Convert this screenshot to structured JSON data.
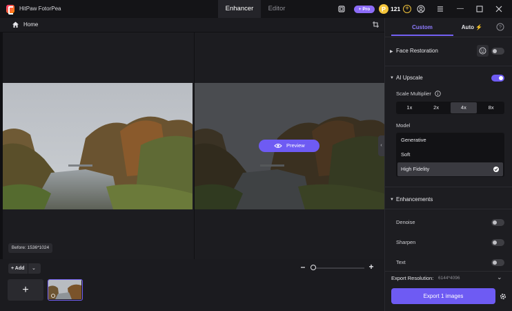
{
  "app": {
    "name": "HitPaw FotorPea"
  },
  "tabs": {
    "enhancer": "Enhancer",
    "editor": "Editor"
  },
  "titlebar": {
    "pro_label": "+ Pro",
    "coins": "121"
  },
  "subbar": {
    "home": "Home"
  },
  "canvas": {
    "preview_label": "Preview",
    "before_label": "Before: 1536*1024"
  },
  "bottom": {
    "add_label": "+ Add"
  },
  "panel": {
    "tab_custom": "Custom",
    "tab_auto": "Auto",
    "face_restoration": {
      "title": "Face Restoration",
      "enabled": false
    },
    "ai_upscale": {
      "title": "AI Upscale",
      "enabled": true,
      "scale_label": "Scale Multiplier",
      "scales": [
        "1x",
        "2x",
        "4x",
        "8x"
      ],
      "selected_scale": "4x",
      "model_label": "Model",
      "models": [
        "Generative",
        "Soft",
        "High Fidelity"
      ],
      "selected_model": "High Fidelity"
    },
    "enhancements": {
      "title": "Enhancements",
      "items": [
        {
          "label": "Denoise",
          "enabled": false
        },
        {
          "label": "Sharpen",
          "enabled": false
        },
        {
          "label": "Text",
          "enabled": false
        }
      ]
    },
    "export_resolution_label": "Export Resolution:",
    "export_resolution_value": "6144*4096",
    "export_button": "Export 1 images"
  },
  "colors": {
    "accent": "#6e5bf3",
    "accent_text": "#8f7cff",
    "coin": "#f4c53b"
  }
}
